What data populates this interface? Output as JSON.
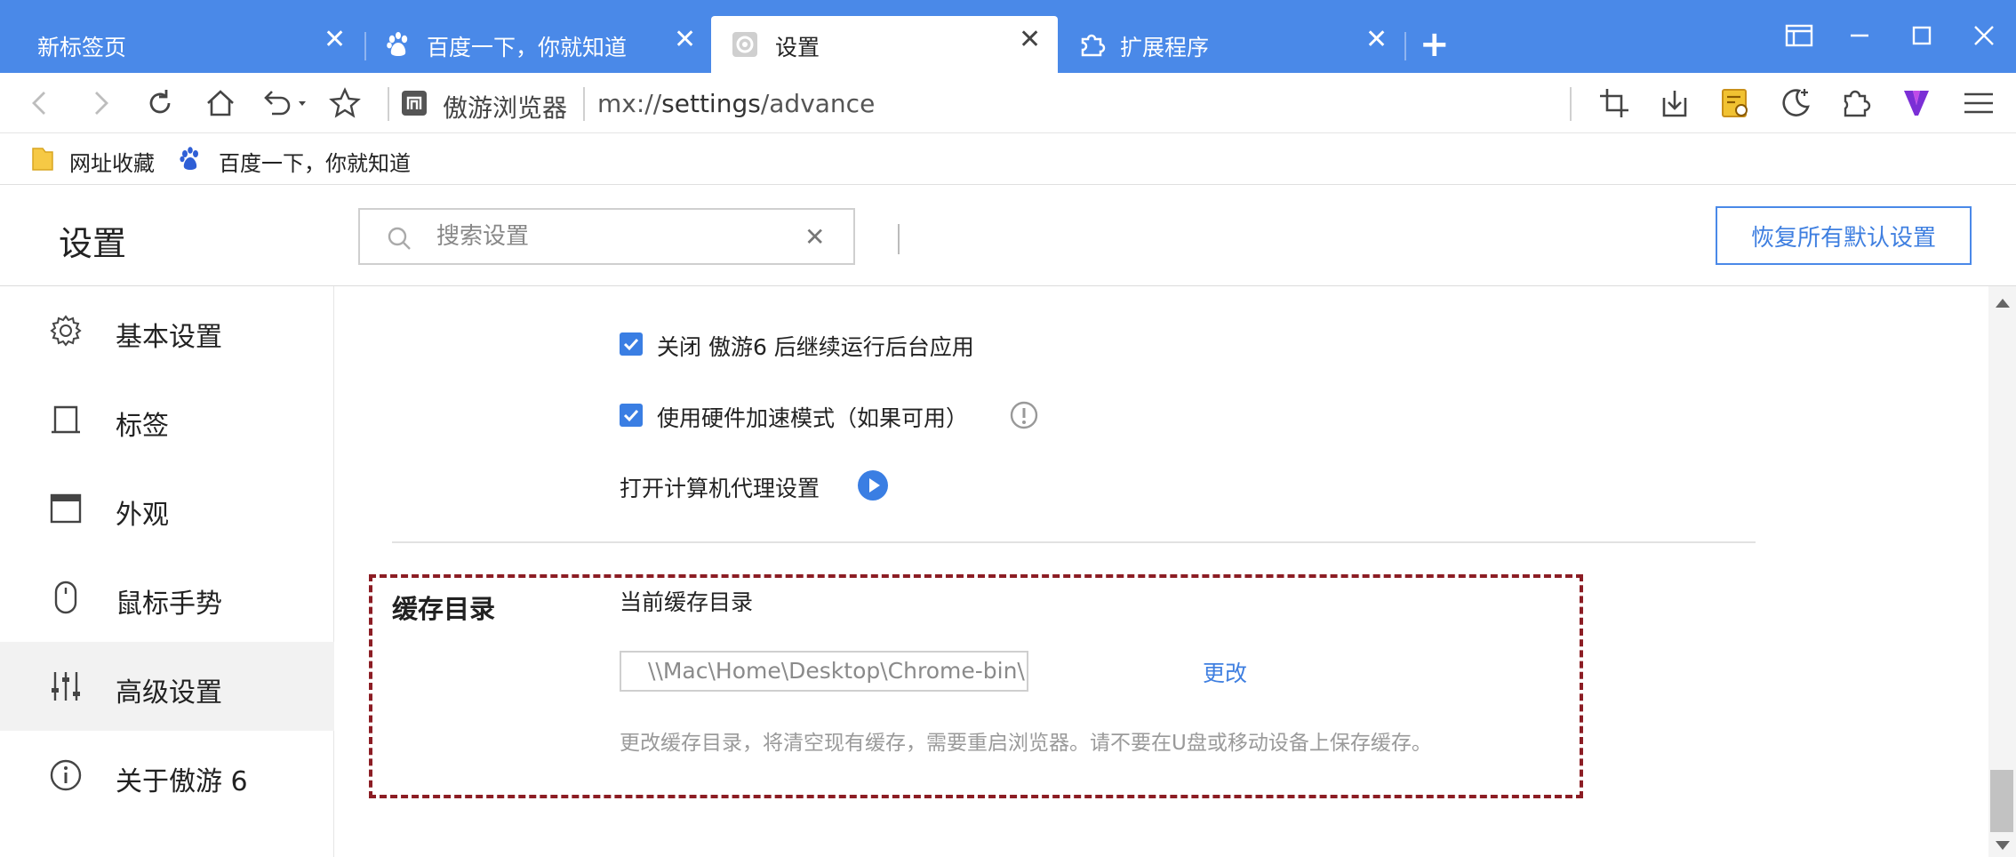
{
  "colors": {
    "titlebar": "#4a89e8",
    "accent": "#3a7ee3",
    "highlight_border": "#8c1d24",
    "sidebar_active": "#f2f2f2"
  },
  "tabs": [
    {
      "label": "新标签页",
      "icon": "none",
      "active": false
    },
    {
      "label": "百度一下，你就知道",
      "icon": "baidu-paw-icon",
      "active": false
    },
    {
      "label": "设置",
      "icon": "gear-icon",
      "active": true
    },
    {
      "label": "扩展程序",
      "icon": "puzzle-icon",
      "active": false
    }
  ],
  "tab_close_symbol": "✕",
  "new_tab_symbol": "+",
  "address": {
    "site_name": "傲游浏览器",
    "url_prefix": "mx://",
    "url_host": "settings",
    "url_path": "/advance"
  },
  "bookmarks": [
    {
      "label": "网址收藏",
      "icon": "folder-icon"
    },
    {
      "label": "百度一下，你就知道",
      "icon": "baidu-paw-icon"
    }
  ],
  "header": {
    "title": "设置",
    "search_placeholder": "搜索设置",
    "clear_symbol": "✕",
    "reset_label": "恢复所有默认设置"
  },
  "sidebar": {
    "items": [
      {
        "label": "基本设置",
        "icon": "gear-icon",
        "active": false
      },
      {
        "label": "标签",
        "icon": "tab-icon",
        "active": false
      },
      {
        "label": "外观",
        "icon": "window-icon",
        "active": false
      },
      {
        "label": "鼠标手势",
        "icon": "mouse-icon",
        "active": false
      },
      {
        "label": "高级设置",
        "icon": "sliders-icon",
        "active": true
      },
      {
        "label": "关于傲游 6",
        "icon": "info-icon",
        "active": false
      }
    ]
  },
  "main": {
    "background_apps_label": "关闭 傲游6 后继续运行后台应用",
    "background_apps_checked": true,
    "hardware_accel_label": "使用硬件加速模式（如果可用）",
    "hardware_accel_checked": true,
    "proxy_label": "打开计算机代理设置",
    "cache": {
      "title": "缓存目录",
      "subtitle": "当前缓存目录",
      "path": "\\\\Mac\\Home\\Desktop\\Chrome-bin\\User Data\\...",
      "change_label": "更改",
      "hint": "更改缓存目录，将清空现有缓存，需要重启浏览器。请不要在U盘或移动设备上保存缓存。"
    }
  }
}
